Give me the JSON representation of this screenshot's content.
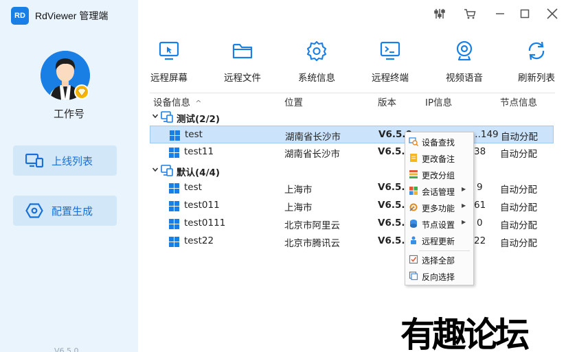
{
  "app": {
    "logo": "RD",
    "title": "RdViewer 管理端",
    "version_footer": "V6.5.0"
  },
  "sidebar": {
    "username": "工作号",
    "items": [
      {
        "label": "上线列表",
        "icon": "monitor-list-icon"
      },
      {
        "label": "配置生成",
        "icon": "hexagon-gear-icon"
      }
    ]
  },
  "window_controls": [
    "tuning-icon",
    "cart-icon",
    "minimize-icon",
    "maximize-icon",
    "close-icon"
  ],
  "toolbar": [
    {
      "label": "远程屏幕",
      "icon": "remote-screen-icon"
    },
    {
      "label": "远程文件",
      "icon": "folder-icon"
    },
    {
      "label": "系统信息",
      "icon": "gear-icon"
    },
    {
      "label": "远程终端",
      "icon": "terminal-icon"
    },
    {
      "label": "视频语音",
      "icon": "webcam-icon"
    },
    {
      "label": "刷新列表",
      "icon": "refresh-icon"
    }
  ],
  "table": {
    "columns": [
      "设备信息",
      "位置",
      "版本",
      "IP信息",
      "节点信息"
    ],
    "sort_indicator": "^",
    "groups": [
      {
        "name": "测试(2/2)",
        "rows": [
          {
            "name": "test",
            "location": "湖南省长沙市",
            "version": "V6.5.0",
            "ip": "...149",
            "node": "自动分配",
            "selected": true
          },
          {
            "name": "test11",
            "location": "湖南省长沙市",
            "version": "V6.5.0",
            "ip": "38",
            "node": "自动分配"
          }
        ]
      },
      {
        "name": "默认(4/4)",
        "rows": [
          {
            "name": "test",
            "location": "上海市",
            "version": "V6.5.0",
            "ip": "9",
            "node": "自动分配"
          },
          {
            "name": "test011",
            "location": "上海市",
            "version": "V6.5.0",
            "ip": "61",
            "node": "自动分配"
          },
          {
            "name": "test0111",
            "location": "北京市阿里云",
            "version": "V6.5.0",
            "ip": "0",
            "node": "自动分配"
          },
          {
            "name": "test22",
            "location": "北京市腾讯云",
            "version": "V6.5.0",
            "ip": "22",
            "node": "自动分配"
          }
        ]
      }
    ]
  },
  "context_menu": [
    {
      "label": "设备查找",
      "icon": "search-device-icon"
    },
    {
      "label": "更改备注",
      "icon": "note-icon"
    },
    {
      "label": "更改分组",
      "icon": "group-icon"
    },
    {
      "label": "会话管理",
      "icon": "session-icon",
      "arrow": "▶"
    },
    {
      "label": "更多功能",
      "icon": "tools-icon",
      "arrow": "▶"
    },
    {
      "label": "节点设置",
      "icon": "node-icon",
      "arrow": "▶"
    },
    {
      "label": "远程更新",
      "icon": "update-icon"
    },
    {
      "label": "选择全部",
      "icon": "select-all-icon"
    },
    {
      "label": "反向选择",
      "icon": "invert-select-icon"
    }
  ],
  "watermark": "有趣论坛",
  "colors": {
    "accent": "#1a7fe5",
    "sidebar_bg": "#eaf4fc",
    "selected_row": "#cce4fb"
  }
}
